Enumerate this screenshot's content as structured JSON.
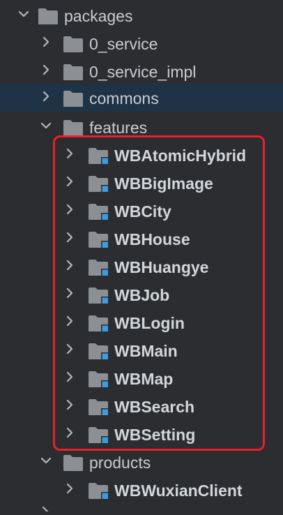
{
  "tree": {
    "root": {
      "label": "packages",
      "expanded": true,
      "icon": "folder-icon"
    },
    "items": [
      {
        "label": "0_service",
        "expanded": false,
        "icon": "folder-icon",
        "module": false
      },
      {
        "label": "0_service_impl",
        "expanded": false,
        "icon": "folder-icon",
        "module": false
      },
      {
        "label": "commons",
        "expanded": false,
        "icon": "folder-icon",
        "module": false,
        "selected": true
      },
      {
        "label": "features",
        "expanded": true,
        "icon": "folder-icon",
        "module": false
      }
    ],
    "features_children": [
      {
        "label": "WBAtomicHybrid",
        "icon": "module-folder-icon"
      },
      {
        "label": "WBBigImage",
        "icon": "module-folder-icon"
      },
      {
        "label": "WBCity",
        "icon": "module-folder-icon"
      },
      {
        "label": "WBHouse",
        "icon": "module-folder-icon"
      },
      {
        "label": "WBHuangye",
        "icon": "module-folder-icon"
      },
      {
        "label": "WBJob",
        "icon": "module-folder-icon"
      },
      {
        "label": "WBLogin",
        "icon": "module-folder-icon"
      },
      {
        "label": "WBMain",
        "icon": "module-folder-icon"
      },
      {
        "label": "WBMap",
        "icon": "module-folder-icon"
      },
      {
        "label": "WBSearch",
        "icon": "module-folder-icon"
      },
      {
        "label": "WBSetting",
        "icon": "module-folder-icon"
      }
    ],
    "products": {
      "label": "products",
      "expanded": true,
      "icon": "folder-icon"
    },
    "products_children": [
      {
        "label": "WBWuxianClient",
        "icon": "module-folder-icon"
      }
    ]
  },
  "colors": {
    "background": "#2b2d30",
    "selected_row": "#1f3347",
    "folder": "#8c8f94",
    "module_marker": "#3d9be0",
    "highlight_border": "#e5232b"
  }
}
